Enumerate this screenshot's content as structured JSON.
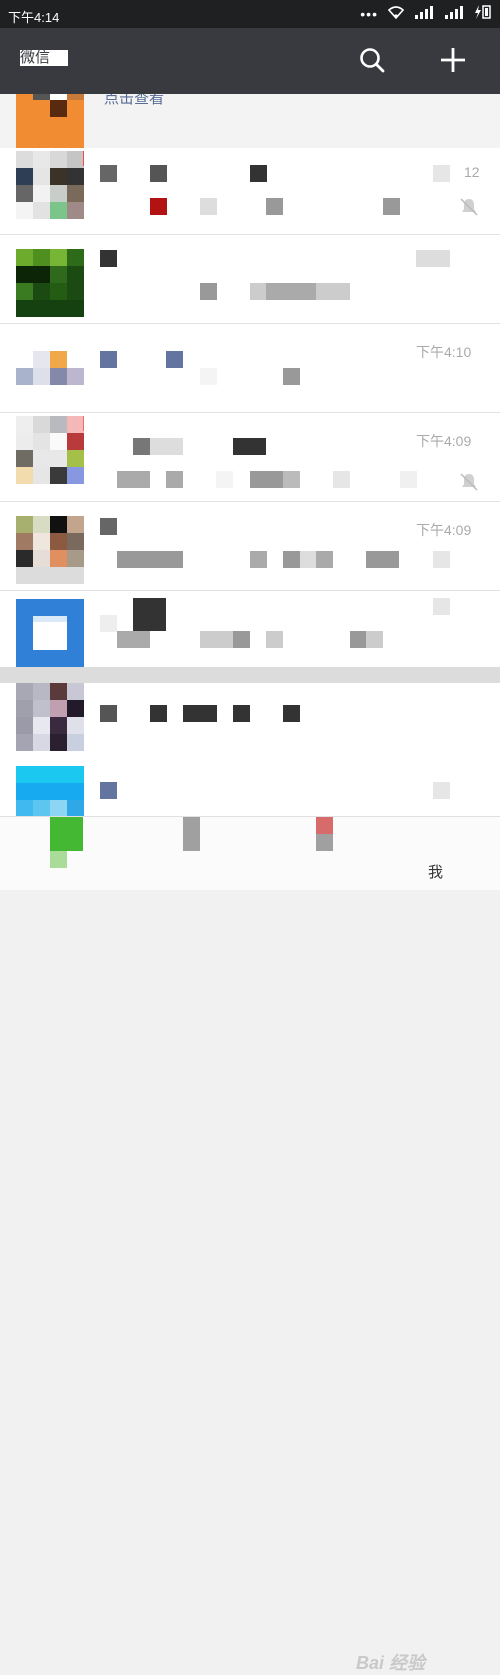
{
  "status_bar": {
    "time": "下午4:14",
    "dots": "•••"
  },
  "header": {
    "title": "微信"
  },
  "pinned": {
    "title": "点击查看"
  },
  "chats": [
    {
      "time": "12"
    },
    {
      "time": ""
    },
    {
      "time": "下午4:10"
    },
    {
      "time": "下午4:09"
    },
    {
      "time": "下午4:09"
    },
    {
      "time": ""
    },
    {
      "time": ""
    },
    {
      "time": ""
    }
  ],
  "tabbar": {
    "me_label": "我"
  },
  "watermark": {
    "text": "Bai 经验"
  },
  "colors": {
    "header_bg": "#393a3f",
    "status_bg": "#1f2022",
    "link_blue": "#576b95"
  }
}
